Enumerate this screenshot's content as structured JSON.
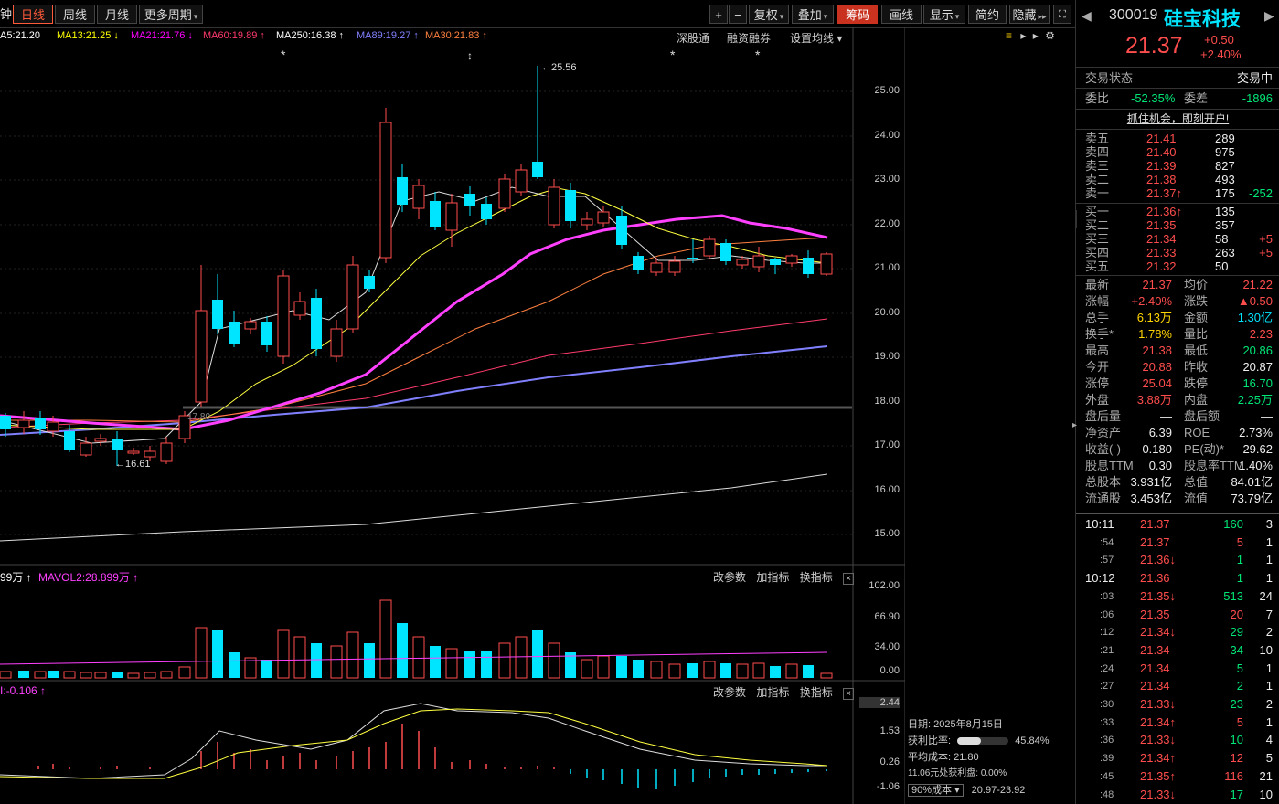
{
  "toolbar": {
    "left_cut": "钟",
    "tabs": [
      "日线",
      "周线",
      "月线",
      "更多周期"
    ],
    "right_buttons": [
      "+",
      "−",
      "复权",
      "叠加",
      "筹码",
      "画线",
      "显示",
      "简约",
      "隐藏"
    ],
    "colors": {
      "active": "#ff5a3a",
      "highlight": "#c8321e"
    }
  },
  "legend": {
    "items": [
      {
        "text": "A5:21.20",
        "color": "#ffffff"
      },
      {
        "text": "MA13:21.25 ↓",
        "color": "#ffff00"
      },
      {
        "text": "MA21:21.76 ↓",
        "color": "#ff00ff"
      },
      {
        "text": "MA60:19.89 ↑",
        "color": "#ff3b6b"
      },
      {
        "text": "MA250:16.38 ↑",
        "color": "#ffffff"
      },
      {
        "text": "MA89:19.27 ↑",
        "color": "#8080ff"
      },
      {
        "text": "MA30:21.83 ↑",
        "color": "#ff8040"
      }
    ],
    "links": [
      "深股通",
      "融资融券",
      "设置均线"
    ]
  },
  "price_axis": [
    "25.00",
    "24.00",
    "23.00",
    "22.00",
    "21.00",
    "20.00",
    "19.00",
    "18.00",
    "17.00",
    "16.00",
    "15.00"
  ],
  "annotations": {
    "high": "25.56",
    "low": "16.61",
    "cost_line": "17.80"
  },
  "volume_panel": {
    "legend": [
      {
        "text": "99万 ↑",
        "color": "#ffffff"
      },
      {
        "text": "MAVOL2:28.899万 ↑",
        "color": "#ff40ff"
      }
    ],
    "buttons": [
      "改参数",
      "加指标",
      "换指标",
      "×"
    ],
    "axis": [
      "102.00",
      "66.90",
      "34.00",
      "0.00"
    ]
  },
  "macd_panel": {
    "legend": [
      {
        "text": "I:-0.106 ↑",
        "color": "#ff40ff"
      }
    ],
    "buttons": [
      "改参数",
      "加指标",
      "换指标",
      "×"
    ],
    "axis": [
      "2.44",
      "1.53",
      "0.26",
      "-1.06"
    ]
  },
  "chip_info": {
    "date": "日期: 2025年8月15日",
    "profit_ratio_label": "获利比率:",
    "profit_ratio": "45.84%",
    "profit_ratio_value": 0.4584,
    "avg_cost": "平均成本: 21.80",
    "profit_at": "11.06元处获利盘: 0.00%",
    "cost_select": "90%成本",
    "cost_range": "20.97-23.92"
  },
  "header": {
    "code": "300019",
    "name": "硅宝科技",
    "price": "21.37",
    "change": "+0.50",
    "pct": "+2.40%"
  },
  "status": {
    "label": "交易状态",
    "value": "交易中"
  },
  "weibi": {
    "l1": "委比",
    "v1": "-52.35%",
    "l2": "委差",
    "v2": "-1896"
  },
  "promo": "抓住机会，即刻开户!",
  "asks": [
    {
      "label": "卖五",
      "price": "21.41",
      "vol": "289",
      "chg": ""
    },
    {
      "label": "卖四",
      "price": "21.40",
      "vol": "975",
      "chg": ""
    },
    {
      "label": "卖三",
      "price": "21.39",
      "vol": "827",
      "chg": ""
    },
    {
      "label": "卖二",
      "price": "21.38",
      "vol": "493",
      "chg": ""
    },
    {
      "label": "卖一",
      "price": "21.37↑",
      "vol": "175",
      "chg": "-252"
    }
  ],
  "bids": [
    {
      "label": "买一",
      "price": "21.36↑",
      "vol": "135",
      "chg": ""
    },
    {
      "label": "买二",
      "price": "21.35",
      "vol": "357",
      "chg": ""
    },
    {
      "label": "买三",
      "price": "21.34",
      "vol": "58",
      "chg": "+5"
    },
    {
      "label": "买四",
      "price": "21.33",
      "vol": "263",
      "chg": "+5"
    },
    {
      "label": "买五",
      "price": "21.32",
      "vol": "50",
      "chg": ""
    }
  ],
  "stats": [
    {
      "l1": "最新",
      "v1": "21.37",
      "c1": "red",
      "l2": "均价",
      "v2": "21.22",
      "c2": "red"
    },
    {
      "l1": "涨幅",
      "v1": "+2.40%",
      "c1": "red",
      "l2": "涨跌",
      "v2": "▲0.50",
      "c2": "red"
    },
    {
      "l1": "总手",
      "v1": "6.13万",
      "c1": "yel",
      "l2": "金额",
      "v2": "1.30亿",
      "c2": "cyan"
    },
    {
      "l1": "换手*",
      "v1": "1.78%",
      "c1": "yel",
      "l2": "量比",
      "v2": "2.23",
      "c2": "red"
    },
    {
      "l1": "最高",
      "v1": "21.38",
      "c1": "red",
      "l2": "最低",
      "v2": "20.86",
      "c2": "green"
    },
    {
      "l1": "今开",
      "v1": "20.88",
      "c1": "red",
      "l2": "昨收",
      "v2": "20.87",
      "c2": "wht"
    },
    {
      "l1": "涨停",
      "v1": "25.04",
      "c1": "red",
      "l2": "跌停",
      "v2": "16.70",
      "c2": "green"
    },
    {
      "l1": "外盘",
      "v1": "3.88万",
      "c1": "red",
      "l2": "内盘",
      "v2": "2.25万",
      "c2": "green"
    },
    {
      "l1": "盘后量",
      "v1": "—",
      "c1": "wht",
      "l2": "盘后额",
      "v2": "—",
      "c2": "wht"
    },
    {
      "l1": "净资产",
      "v1": "6.39",
      "c1": "wht",
      "l2": "ROE",
      "v2": "2.73%",
      "c2": "wht"
    },
    {
      "l1": "收益(-)",
      "v1": "0.180",
      "c1": "wht",
      "l2": "PE(动)*",
      "v2": "29.62",
      "c2": "wht"
    },
    {
      "l1": "股息TTM",
      "v1": "0.30",
      "c1": "wht",
      "l2": "股息率TTM",
      "v2": "1.40%",
      "c2": "wht"
    },
    {
      "l1": "总股本",
      "v1": "3.931亿",
      "c1": "wht",
      "l2": "总值",
      "v2": "84.01亿",
      "c2": "wht"
    },
    {
      "l1": "流通股",
      "v1": "3.453亿",
      "c1": "wht",
      "l2": "流值",
      "v2": "73.79亿",
      "c2": "wht"
    }
  ],
  "ticks": [
    {
      "time": "10:11",
      "price": "21.37",
      "vol": "160",
      "n": "3",
      "pc": "red",
      "vc": "green"
    },
    {
      "time": ":54",
      "price": "21.37",
      "vol": "5",
      "n": "1",
      "pc": "red",
      "vc": "red"
    },
    {
      "time": ":57",
      "price": "21.36↓",
      "vol": "1",
      "n": "1",
      "pc": "red",
      "vc": "green"
    },
    {
      "time": "10:12",
      "price": "21.36",
      "vol": "1",
      "n": "1",
      "pc": "red",
      "vc": "green"
    },
    {
      "time": ":03",
      "price": "21.35↓",
      "vol": "513",
      "n": "24",
      "pc": "red",
      "vc": "green"
    },
    {
      "time": ":06",
      "price": "21.35",
      "vol": "20",
      "n": "7",
      "pc": "red",
      "vc": "red"
    },
    {
      "time": ":12",
      "price": "21.34↓",
      "vol": "29",
      "n": "2",
      "pc": "red",
      "vc": "green"
    },
    {
      "time": ":21",
      "price": "21.34",
      "vol": "34",
      "n": "10",
      "pc": "red",
      "vc": "green"
    },
    {
      "time": ":24",
      "price": "21.34",
      "vol": "5",
      "n": "1",
      "pc": "red",
      "vc": "green"
    },
    {
      "time": ":27",
      "price": "21.34",
      "vol": "2",
      "n": "1",
      "pc": "red",
      "vc": "green"
    },
    {
      "time": ":30",
      "price": "21.33↓",
      "vol": "23",
      "n": "2",
      "pc": "red",
      "vc": "green"
    },
    {
      "time": ":33",
      "price": "21.34↑",
      "vol": "5",
      "n": "1",
      "pc": "red",
      "vc": "red"
    },
    {
      "time": ":36",
      "price": "21.33↓",
      "vol": "10",
      "n": "4",
      "pc": "red",
      "vc": "green"
    },
    {
      "time": ":39",
      "price": "21.34↑",
      "vol": "12",
      "n": "5",
      "pc": "red",
      "vc": "red"
    },
    {
      "time": ":45",
      "price": "21.35↑",
      "vol": "116",
      "n": "21",
      "pc": "red",
      "vc": "red"
    },
    {
      "time": ":48",
      "price": "21.33↓",
      "vol": "17",
      "n": "10",
      "pc": "red",
      "vc": "green"
    }
  ]
}
